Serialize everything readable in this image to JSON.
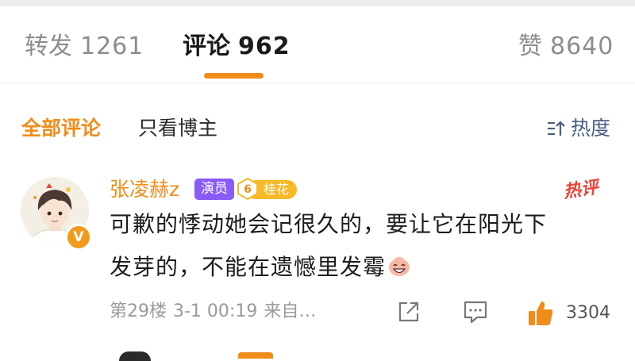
{
  "tabs": {
    "repost": {
      "label": "转发",
      "count": "1261"
    },
    "comments": {
      "label": "评论",
      "count": "962"
    },
    "likes": {
      "label": "赞",
      "count": "8640"
    }
  },
  "filters": {
    "all": "全部评论",
    "owner_only": "只看博主",
    "sort": "热度"
  },
  "comment": {
    "username": "张凌赫z",
    "role_badge": "演员",
    "fan_level": "6",
    "fan_badge": "桂花",
    "hot_label": "热评",
    "text_line1": "可歉的悸动她会记很久的，要让它在阳光下",
    "text_line2": "发芽的，不能在遗憾里发霉",
    "floor": "第29楼",
    "time": "3-1 00:19",
    "source": "来自…",
    "likes": "3304",
    "verified_mark": "V"
  },
  "colors": {
    "accent": "#f08c1a",
    "actor_badge": "#8a5cf6",
    "fan_badge": "#f7b928",
    "hot": "#e8463c",
    "sort": "#4a5f80"
  },
  "icons": {
    "sort": "sort-lines-icon",
    "share": "share-icon",
    "reply": "comment-icon",
    "like": "thumbs-up-icon",
    "emoji": "smiling-emoji-icon"
  }
}
